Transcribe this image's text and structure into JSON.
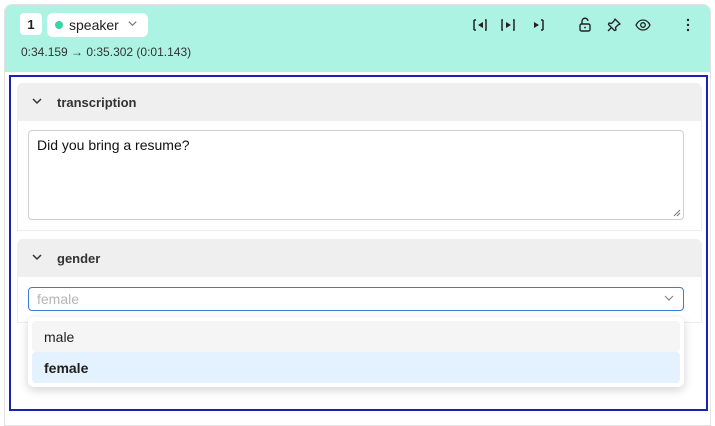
{
  "header": {
    "segment_number": "1",
    "speaker_label": "speaker",
    "speaker_color": "#37d4a6",
    "time_range": "0:34.159 → 0:35.302 (0:01.143)",
    "background_color": "#adf3e3",
    "tools": [
      "skip-to-start-icon",
      "play-segment-icon",
      "skip-to-end-icon",
      "unlock-icon",
      "pin-icon",
      "eye-icon",
      "more-vertical-icon"
    ]
  },
  "transcription": {
    "section_label": "transcription",
    "value": "Did you bring a resume?"
  },
  "gender": {
    "section_label": "gender",
    "placeholder": "female",
    "options": [
      "male",
      "female"
    ],
    "selected": "female"
  },
  "outline_color": "#1a22b3"
}
